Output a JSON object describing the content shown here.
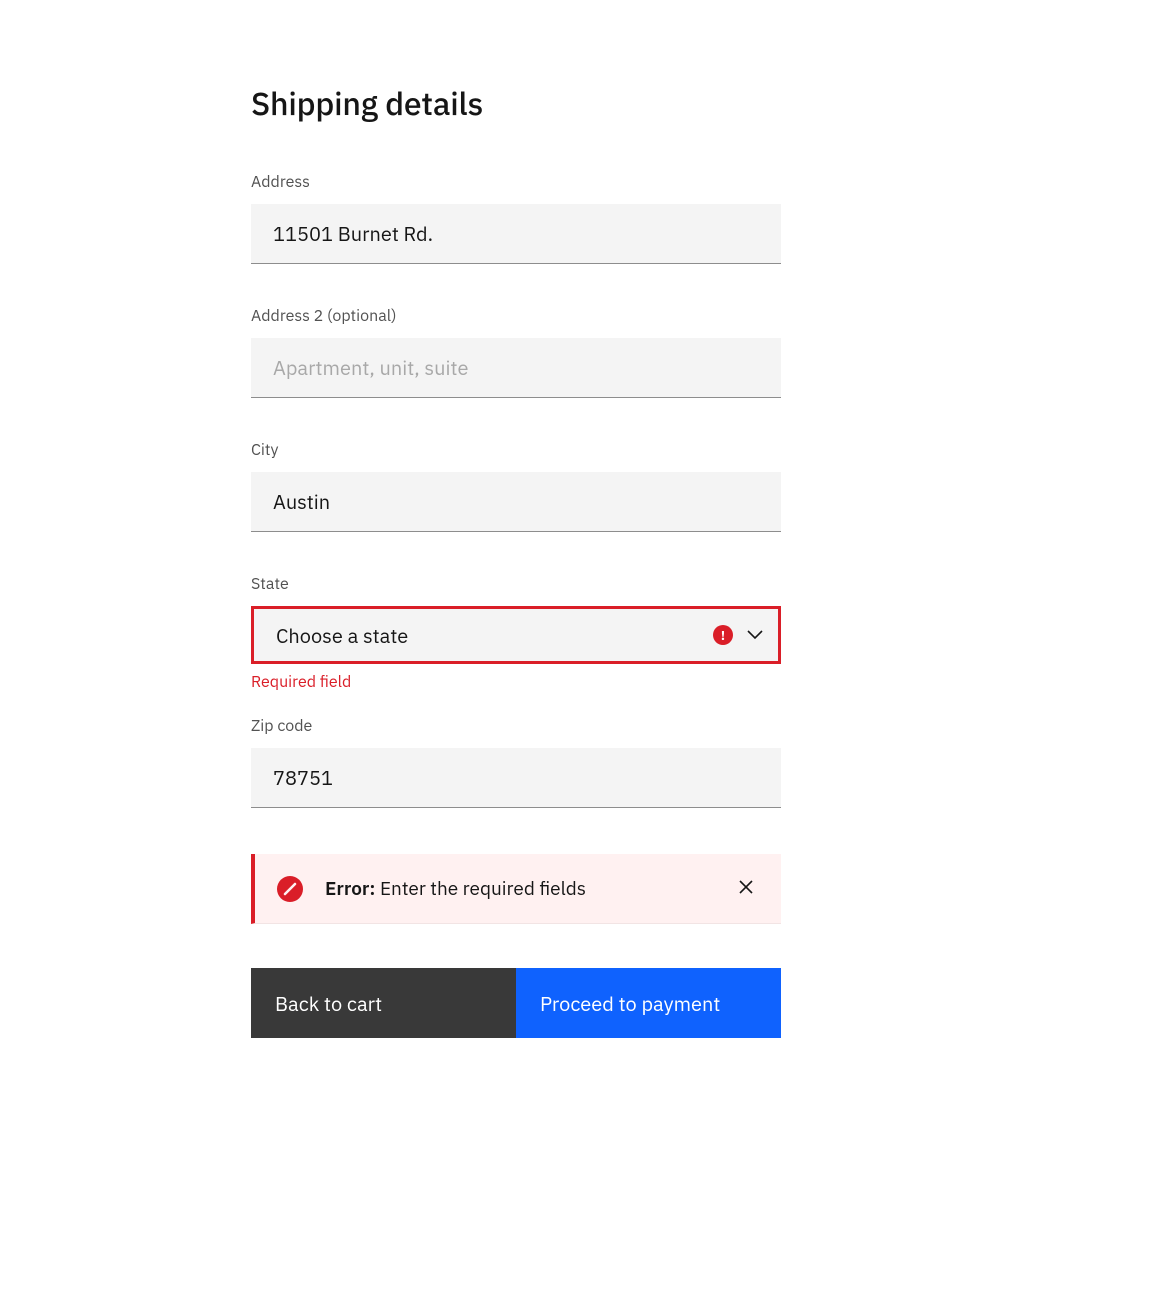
{
  "title": "Shipping details",
  "fields": {
    "address": {
      "label": "Address",
      "value": "11501 Burnet Rd."
    },
    "address2": {
      "label": "Address 2 (optional)",
      "value": "",
      "placeholder": "Apartment, unit, suite"
    },
    "city": {
      "label": "City",
      "value": "Austin"
    },
    "state": {
      "label": "State",
      "selected": "Choose a state",
      "error": "Required field"
    },
    "zip": {
      "label": "Zip code",
      "value": "78751"
    }
  },
  "notification": {
    "title": "Error:",
    "message": "Enter the required fields"
  },
  "buttons": {
    "back": "Back to cart",
    "proceed": "Proceed to payment"
  },
  "colors": {
    "error": "#da1e28",
    "primary": "#0f62fe",
    "secondary": "#393939",
    "field_bg": "#f4f4f4"
  }
}
